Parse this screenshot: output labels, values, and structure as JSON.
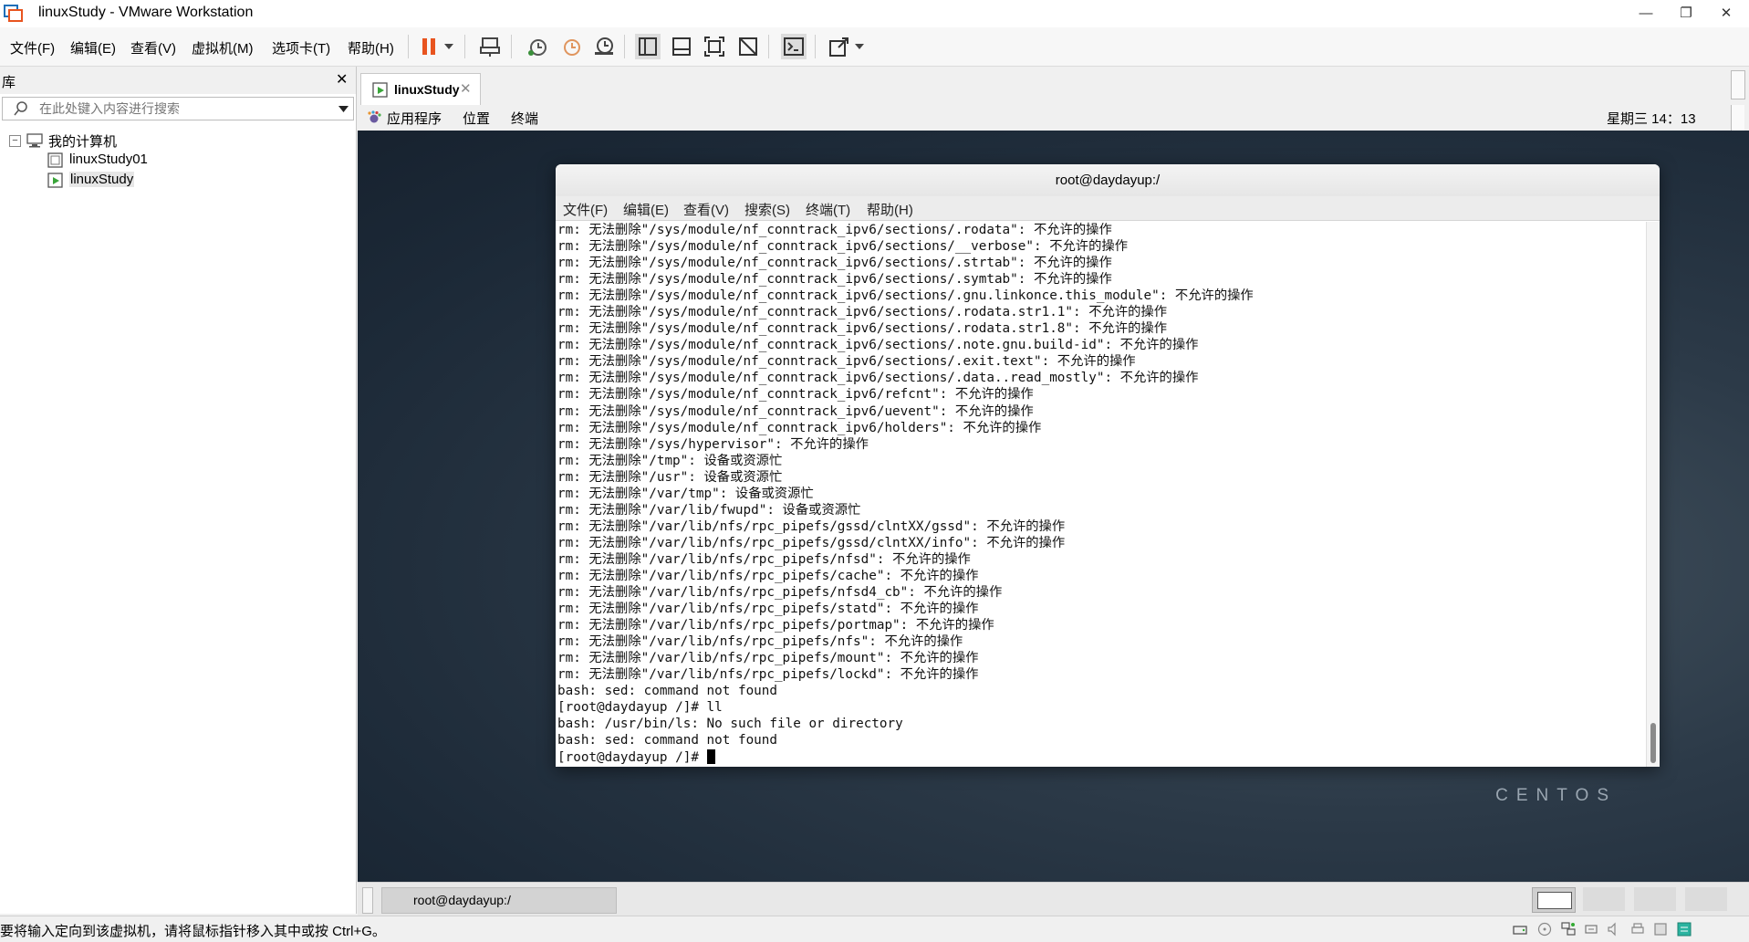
{
  "window": {
    "title": "linuxStudy - VMware Workstation"
  },
  "menu": {
    "items": [
      "文件(F)",
      "编辑(E)",
      "查看(V)",
      "虚拟机(M)",
      "选项卡(T)",
      "帮助(H)"
    ]
  },
  "toolbar": {
    "icons": [
      "pause-icon",
      "dropdown-icon",
      "send-ctrl-alt-del-icon",
      "snapshot-take-icon",
      "snapshot-revert-icon",
      "snapshot-manager-icon",
      "library-view-icon",
      "thumbnail-view-icon",
      "fullscreen-icon",
      "unity-icon",
      "console-icon",
      "stretch-icon",
      "stretch-dropdown-icon"
    ],
    "accent": "#e8541f"
  },
  "library": {
    "title": "库",
    "search_placeholder": "在此处键入内容进行搜索",
    "root": "我的计算机",
    "vms": [
      "linuxStudy01",
      "linuxStudy"
    ]
  },
  "vm_tab": {
    "label": "linuxStudy"
  },
  "gnome": {
    "applications": "应用程序",
    "places": "位置",
    "terminal": "终端",
    "clock": "星期三 14：13"
  },
  "terminal": {
    "title": "root@daydayup:/",
    "menu": [
      "文件(F)",
      "编辑(E)",
      "查看(V)",
      "搜索(S)",
      "终端(T)",
      "帮助(H)"
    ],
    "lines": [
      "rm: 无法删除\"/sys/module/nf_conntrack_ipv6/sections/.rodata\": 不允许的操作",
      "rm: 无法删除\"/sys/module/nf_conntrack_ipv6/sections/__verbose\": 不允许的操作",
      "rm: 无法删除\"/sys/module/nf_conntrack_ipv6/sections/.strtab\": 不允许的操作",
      "rm: 无法删除\"/sys/module/nf_conntrack_ipv6/sections/.symtab\": 不允许的操作",
      "rm: 无法删除\"/sys/module/nf_conntrack_ipv6/sections/.gnu.linkonce.this_module\": 不允许的操作",
      "rm: 无法删除\"/sys/module/nf_conntrack_ipv6/sections/.rodata.str1.1\": 不允许的操作",
      "rm: 无法删除\"/sys/module/nf_conntrack_ipv6/sections/.rodata.str1.8\": 不允许的操作",
      "rm: 无法删除\"/sys/module/nf_conntrack_ipv6/sections/.note.gnu.build-id\": 不允许的操作",
      "rm: 无法删除\"/sys/module/nf_conntrack_ipv6/sections/.exit.text\": 不允许的操作",
      "rm: 无法删除\"/sys/module/nf_conntrack_ipv6/sections/.data..read_mostly\": 不允许的操作",
      "rm: 无法删除\"/sys/module/nf_conntrack_ipv6/refcnt\": 不允许的操作",
      "rm: 无法删除\"/sys/module/nf_conntrack_ipv6/uevent\": 不允许的操作",
      "rm: 无法删除\"/sys/module/nf_conntrack_ipv6/holders\": 不允许的操作",
      "rm: 无法删除\"/sys/hypervisor\": 不允许的操作",
      "rm: 无法删除\"/tmp\": 设备或资源忙",
      "rm: 无法删除\"/usr\": 设备或资源忙",
      "rm: 无法删除\"/var/tmp\": 设备或资源忙",
      "rm: 无法删除\"/var/lib/fwupd\": 设备或资源忙",
      "rm: 无法删除\"/var/lib/nfs/rpc_pipefs/gssd/clntXX/gssd\": 不允许的操作",
      "rm: 无法删除\"/var/lib/nfs/rpc_pipefs/gssd/clntXX/info\": 不允许的操作",
      "rm: 无法删除\"/var/lib/nfs/rpc_pipefs/nfsd\": 不允许的操作",
      "rm: 无法删除\"/var/lib/nfs/rpc_pipefs/cache\": 不允许的操作",
      "rm: 无法删除\"/var/lib/nfs/rpc_pipefs/nfsd4_cb\": 不允许的操作",
      "rm: 无法删除\"/var/lib/nfs/rpc_pipefs/statd\": 不允许的操作",
      "rm: 无法删除\"/var/lib/nfs/rpc_pipefs/portmap\": 不允许的操作",
      "rm: 无法删除\"/var/lib/nfs/rpc_pipefs/nfs\": 不允许的操作",
      "rm: 无法删除\"/var/lib/nfs/rpc_pipefs/mount\": 不允许的操作",
      "rm: 无法删除\"/var/lib/nfs/rpc_pipefs/lockd\": 不允许的操作",
      "bash: sed: command not found",
      "[root@daydayup /]# ll",
      "bash: /usr/bin/ls: No such file or directory",
      "bash: sed: command not found"
    ],
    "prompt": "[root@daydayup /]# "
  },
  "desktop": {
    "watermark": "CENTOS"
  },
  "taskbar": {
    "item": "root@daydayup:/"
  },
  "status": {
    "text": "要将输入定向到该虚拟机，请将鼠标指针移入其中或按 Ctrl+G。"
  }
}
